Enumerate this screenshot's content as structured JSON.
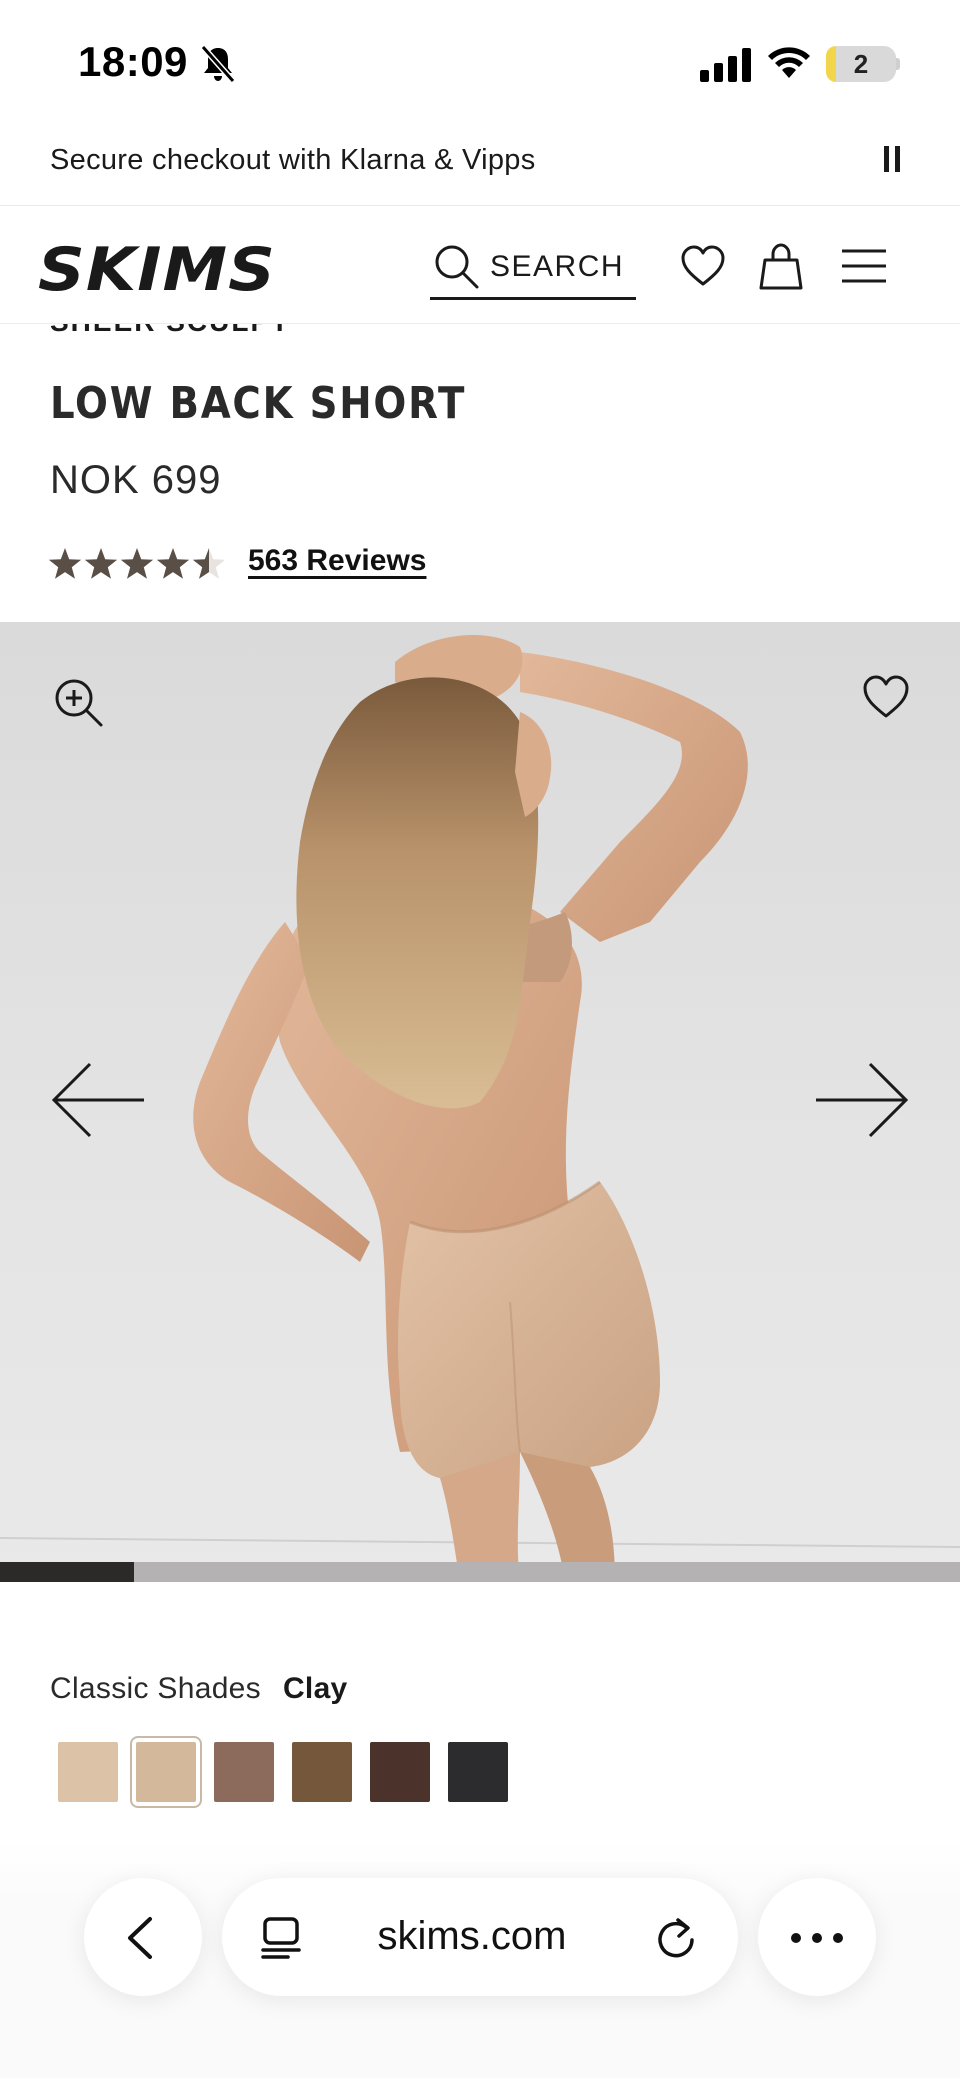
{
  "status_bar": {
    "time": "18:09",
    "battery_level": "2"
  },
  "promo": {
    "text": "Secure checkout with Klarna & Vipps"
  },
  "header": {
    "logo_text": "SKIMS",
    "search_label": "SEARCH"
  },
  "product": {
    "collection": "SHEER SCULPT",
    "title": "LOW BACK SHORT",
    "price": "NOK 699",
    "rating": 4.5,
    "rating_max": 5,
    "reviews_label": "563 Reviews"
  },
  "gallery": {
    "progress": 0.14
  },
  "colors": {
    "group_label": "Classic Shades",
    "selected_label": "Clay",
    "swatches": [
      {
        "hex": "#dcc3a8"
      },
      {
        "hex": "#d4b89c",
        "selected": true
      },
      {
        "hex": "#8c6b5c"
      },
      {
        "hex": "#75583c"
      },
      {
        "hex": "#4b322a"
      },
      {
        "hex": "#2c2c2e"
      }
    ]
  },
  "browser": {
    "url": "skims.com"
  },
  "theme": {
    "star_color": "#5a4f47",
    "star_empty": "#e6e3e1",
    "progress_fill": "#2c2a28"
  }
}
